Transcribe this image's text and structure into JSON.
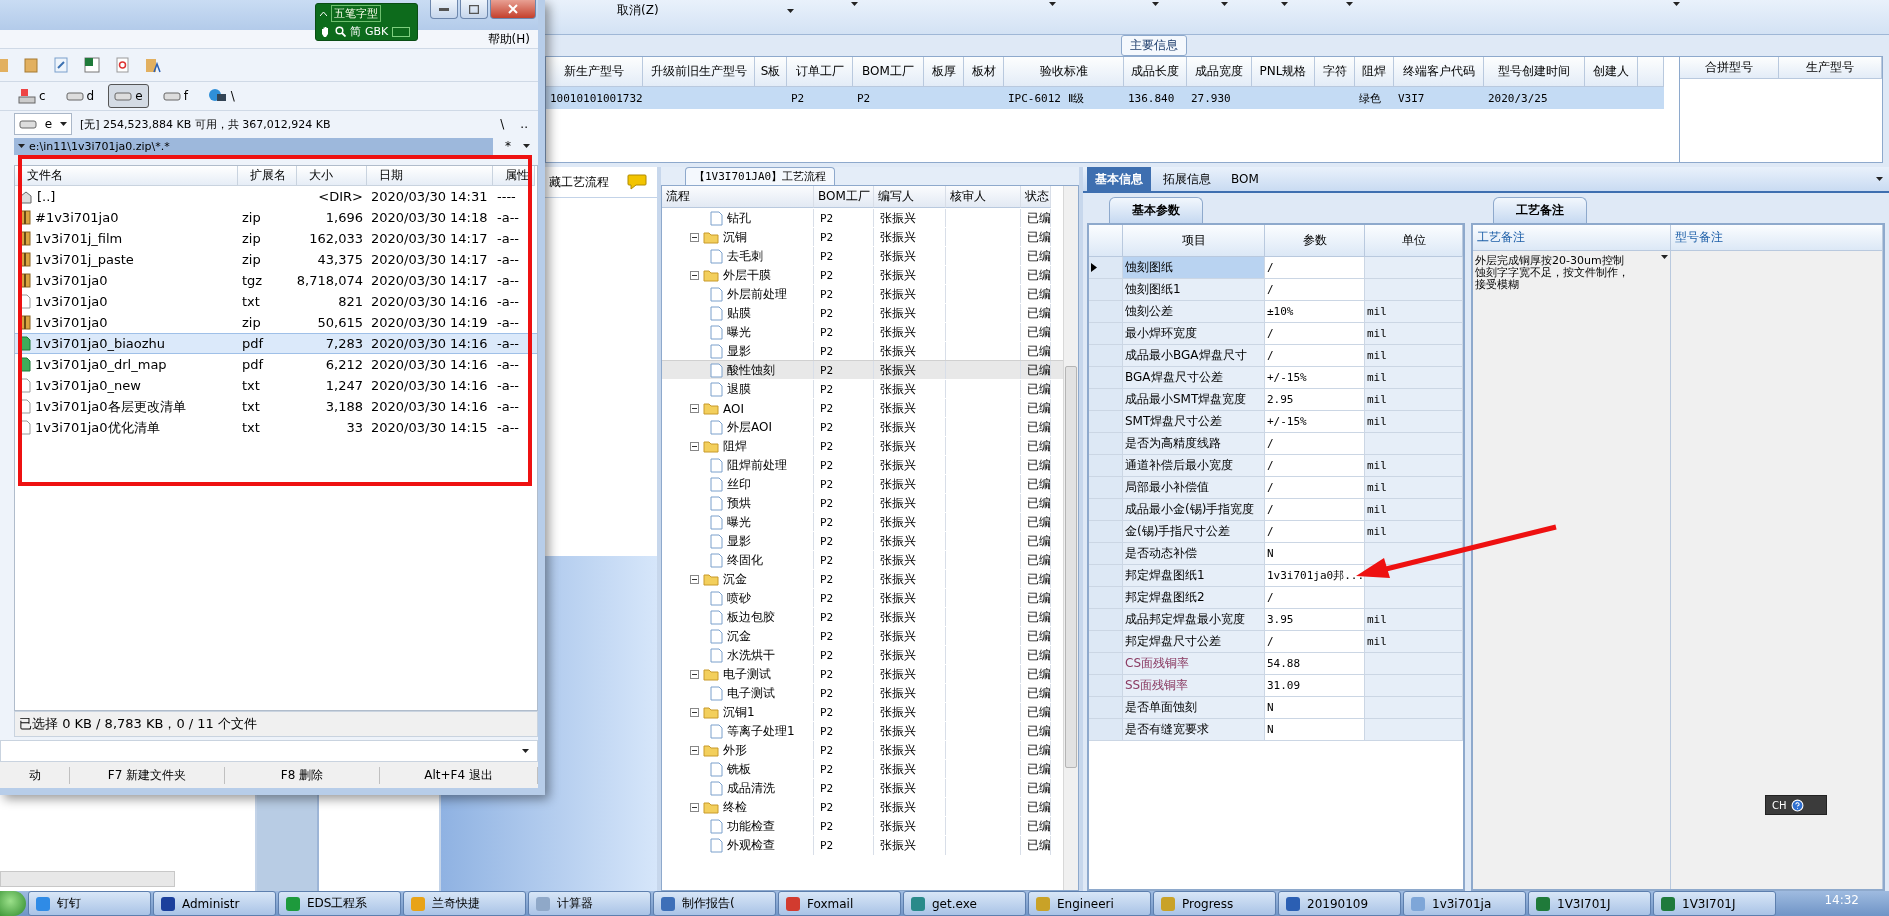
{
  "top_toolbar": {
    "cancel": "取消(Z)"
  },
  "main_info": {
    "title": "主要信息",
    "columns": [
      "新生产型号",
      "升级前旧生产型号",
      "S板",
      "订单工厂",
      "BOM工厂",
      "板厚",
      "板材",
      "验收标准",
      "成品长度",
      "成品宽度",
      "PNL规格",
      "字符",
      "阻焊",
      "终端客户代码",
      "型号创建时间",
      "创建人"
    ],
    "rows": [
      {
        "selected": true,
        "cells": [
          "10010101001732",
          null,
          null,
          "P2",
          "P2",
          null,
          null,
          "IPC-6012 Ⅱ级",
          "136.840",
          "27.930",
          null,
          null,
          "绿色",
          "V3I7",
          "2020/3/25",
          null
        ]
      }
    ],
    "side_columns": [
      "合拼型号",
      "生产型号"
    ]
  },
  "hidden_panel": {
    "tab": "藏工艺流程"
  },
  "process_flow": {
    "title": "【1V3I701JA0】工艺流程",
    "columns": [
      "流程",
      "BOM工厂",
      "编写人",
      "核审人",
      "状态"
    ],
    "groups": [
      {
        "children": [
          {
            "label": "钻孔",
            "bom": "P2",
            "writer": "张振兴",
            "status": "已编",
            "selected": false
          }
        ]
      },
      {
        "label": "沉铜",
        "bom": "P2",
        "writer": "张振兴",
        "status": "已编",
        "selected": false,
        "expanded": true,
        "children": [
          {
            "label": "去毛刺",
            "bom": "P2",
            "writer": "张振兴",
            "status": "已编",
            "selected": false
          }
        ]
      },
      {
        "label": "外层干膜",
        "bom": "P2",
        "writer": "张振兴",
        "status": "已编",
        "selected": false,
        "expanded": true,
        "children": [
          {
            "label": "外层前处理",
            "bom": "P2",
            "writer": "张振兴",
            "status": "已编",
            "selected": false
          },
          {
            "label": "贴膜",
            "bom": "P2",
            "writer": "张振兴",
            "status": "已编",
            "selected": false
          },
          {
            "label": "曝光",
            "bom": "P2",
            "writer": "张振兴",
            "status": "已编",
            "selected": false
          },
          {
            "label": "显影",
            "bom": "P2",
            "writer": "张振兴",
            "status": "已编",
            "selected": false
          },
          {
            "label": "酸性蚀刻",
            "bom": "P2",
            "writer": "张振兴",
            "status": "已编",
            "selected": true
          },
          {
            "label": "退膜",
            "bom": "P2",
            "writer": "张振兴",
            "status": "已编",
            "selected": false
          }
        ]
      },
      {
        "label": "AOI",
        "bom": "P2",
        "writer": "张振兴",
        "status": "已编",
        "selected": false,
        "expanded": true,
        "children": [
          {
            "label": "外层AOI",
            "bom": "P2",
            "writer": "张振兴",
            "status": "已编",
            "selected": false
          }
        ]
      },
      {
        "label": "阻焊",
        "bom": "P2",
        "writer": "张振兴",
        "status": "已编",
        "selected": false,
        "expanded": true,
        "children": [
          {
            "label": "阻焊前处理",
            "bom": "P2",
            "writer": "张振兴",
            "status": "已编",
            "selected": false
          },
          {
            "label": "丝印",
            "bom": "P2",
            "writer": "张振兴",
            "status": "已编",
            "selected": false
          },
          {
            "label": "预烘",
            "bom": "P2",
            "writer": "张振兴",
            "status": "已编",
            "selected": false
          },
          {
            "label": "曝光",
            "bom": "P2",
            "writer": "张振兴",
            "status": "已编",
            "selected": false
          },
          {
            "label": "显影",
            "bom": "P2",
            "writer": "张振兴",
            "status": "已编",
            "selected": false
          },
          {
            "label": "终固化",
            "bom": "P2",
            "writer": "张振兴",
            "status": "已编",
            "selected": false
          }
        ]
      },
      {
        "label": "沉金",
        "bom": "P2",
        "writer": "张振兴",
        "status": "已编",
        "selected": false,
        "expanded": true,
        "children": [
          {
            "label": "喷砂",
            "bom": "P2",
            "writer": "张振兴",
            "status": "已编",
            "selected": false
          },
          {
            "label": "板边包胶",
            "bom": "P2",
            "writer": "张振兴",
            "status": "已编",
            "selected": false
          },
          {
            "label": "沉金",
            "bom": "P2",
            "writer": "张振兴",
            "status": "已编",
            "selected": false
          },
          {
            "label": "水洗烘干",
            "bom": "P2",
            "writer": "张振兴",
            "status": "已编",
            "selected": false
          }
        ]
      },
      {
        "label": "电子测试",
        "bom": "P2",
        "writer": "张振兴",
        "status": "已编",
        "selected": false,
        "expanded": true,
        "children": [
          {
            "label": "电子测试",
            "bom": "P2",
            "writer": "张振兴",
            "status": "已编",
            "selected": false
          }
        ]
      },
      {
        "label": "沉铜1",
        "bom": "P2",
        "writer": "张振兴",
        "status": "已编",
        "selected": false,
        "expanded": true,
        "children": [
          {
            "label": "等离子处理1",
            "bom": "P2",
            "writer": "张振兴",
            "status": "已编",
            "selected": false
          }
        ]
      },
      {
        "label": "外形",
        "bom": "P2",
        "writer": "张振兴",
        "status": "已编",
        "selected": false,
        "expanded": true,
        "children": [
          {
            "label": "铣板",
            "bom": "P2",
            "writer": "张振兴",
            "status": "已编",
            "selected": false
          },
          {
            "label": "成品清洗",
            "bom": "P2",
            "writer": "张振兴",
            "status": "已编",
            "selected": false
          }
        ]
      },
      {
        "label": "终检",
        "bom": "P2",
        "writer": "张振兴",
        "status": "已编",
        "selected": false,
        "expanded": true,
        "children": [
          {
            "label": "功能检查",
            "bom": "P2",
            "writer": "张振兴",
            "status": "已编",
            "selected": false
          },
          {
            "label": "外观检查",
            "bom": "P2",
            "writer": "张振兴",
            "status": "已编",
            "selected": false
          }
        ]
      }
    ]
  },
  "detail": {
    "tabs": [
      {
        "label": "基本信息",
        "selected": true
      },
      {
        "label": "拓展信息",
        "selected": false
      },
      {
        "label": "BOM",
        "selected": false
      }
    ],
    "params": {
      "tab": "基本参数",
      "columns": [
        "项目",
        "参数",
        "单位"
      ],
      "rows": [
        {
          "item": "蚀刻图纸",
          "value": "/",
          "selected": true,
          "emphasized": false
        },
        {
          "item": "蚀刻图纸1",
          "value": "/",
          "selected": false,
          "emphasized": false
        },
        {
          "item": "蚀刻公差",
          "value": "±10%",
          "unit": "mil",
          "selected": false,
          "emphasized": false
        },
        {
          "item": "最小焊环宽度",
          "value": "/",
          "unit": "mil",
          "selected": false,
          "emphasized": false
        },
        {
          "item": "成品最小BGA焊盘尺寸",
          "value": "/",
          "unit": "mil",
          "selected": false,
          "emphasized": false
        },
        {
          "item": "BGA焊盘尺寸公差",
          "value": "+/-15%",
          "unit": "mil",
          "selected": false,
          "emphasized": false
        },
        {
          "item": "成品最小SMT焊盘宽度",
          "value": "2.95",
          "unit": "mil",
          "selected": false,
          "emphasized": false
        },
        {
          "item": "SMT焊盘尺寸公差",
          "value": "+/-15%",
          "unit": "mil",
          "selected": false,
          "emphasized": false
        },
        {
          "item": "是否为高精度线路",
          "value": "/",
          "selected": false,
          "emphasized": false
        },
        {
          "item": "通道补偿后最小宽度",
          "value": "/",
          "unit": "mil",
          "selected": false,
          "emphasized": false
        },
        {
          "item": "局部最小补偿值",
          "value": "/",
          "unit": "mil",
          "selected": false,
          "emphasized": false
        },
        {
          "item": "成品最小金(锡)手指宽度",
          "value": "/",
          "unit": "mil",
          "selected": false,
          "emphasized": false
        },
        {
          "item": "金(锡)手指尺寸公差",
          "value": "/",
          "unit": "mil",
          "selected": false,
          "emphasized": false
        },
        {
          "item": "是否动态补偿",
          "value": "N",
          "selected": false,
          "emphasized": false
        },
        {
          "item": "邦定焊盘图纸1",
          "value": "1v3i701ja0邦...",
          "selected": false,
          "emphasized": false
        },
        {
          "item": "邦定焊盘图纸2",
          "value": "/",
          "selected": false,
          "emphasized": false
        },
        {
          "item": "成品邦定焊盘最小宽度",
          "value": "3.95",
          "unit": "mil",
          "selected": false,
          "emphasized": false
        },
        {
          "item": "邦定焊盘尺寸公差",
          "value": "/",
          "unit": "mil",
          "selected": false,
          "emphasized": false
        },
        {
          "item": "CS面残铜率",
          "value": "54.88",
          "selected": false,
          "emphasized": true
        },
        {
          "item": "SS面残铜率",
          "value": "31.09",
          "selected": false,
          "emphasized": true
        },
        {
          "item": "是否单面蚀刻",
          "value": "N",
          "selected": false,
          "emphasized": false
        },
        {
          "item": "是否有缝宽要求",
          "value": "N",
          "selected": false,
          "emphasized": false
        }
      ]
    },
    "notes": {
      "tab": "工艺备注",
      "columns": [
        "工艺备注",
        "型号备注"
      ],
      "process_note": [
        "外层完成铜厚按20-30um控制",
        "蚀刻字字宽不足，按文件制作，",
        "接受模糊"
      ]
    }
  },
  "language_bar": {
    "code": "CH"
  },
  "file_manager": {
    "menu": [
      "帮助(H)"
    ],
    "ime_bar": {
      "mode": "五笔字型",
      "charset": "简",
      "encoding": "GBK"
    },
    "drives": [
      {
        "letter": "c",
        "kind": "system",
        "selected": false
      },
      {
        "letter": "d",
        "kind": "disk",
        "selected": false
      },
      {
        "letter": "e",
        "kind": "disk",
        "selected": true
      },
      {
        "letter": "f",
        "kind": "disk",
        "selected": false
      },
      {
        "letter": "\\",
        "kind": "network",
        "selected": false
      }
    ],
    "drive_select": "e",
    "free_space": "[无] 254,523,884 KB 可用，共 367,012,924 KB",
    "root_button": "\\",
    "up_button": "..",
    "path": "e:\\in11\\1v3i701ja0.zip\\*.*",
    "filter_button": "*",
    "columns": [
      "文件名",
      "扩展名",
      "大小",
      "日期",
      "属性"
    ],
    "files": [
      {
        "name": "[..]",
        "kind": "up",
        "size": "<DIR>",
        "date": "2020/03/30 14:31",
        "attr": "----",
        "selected": false
      },
      {
        "name": "#1v3i701ja0",
        "ext": "zip",
        "kind": "archive",
        "size": "1,696",
        "date": "2020/03/30 14:18",
        "attr": "-a--",
        "selected": false
      },
      {
        "name": "1v3i701j_film",
        "ext": "zip",
        "kind": "archive",
        "size": "162,033",
        "date": "2020/03/30 14:17",
        "attr": "-a--",
        "selected": false
      },
      {
        "name": "1v3i701j_paste",
        "ext": "zip",
        "kind": "archive",
        "size": "43,375",
        "date": "2020/03/30 14:17",
        "attr": "-a--",
        "selected": false
      },
      {
        "name": "1v3i701ja0",
        "ext": "tgz",
        "kind": "archive",
        "size": "8,718,074",
        "date": "2020/03/30 14:17",
        "attr": "-a--",
        "selected": false
      },
      {
        "name": "1v3i701ja0",
        "ext": "txt",
        "kind": "text",
        "size": "821",
        "date": "2020/03/30 14:16",
        "attr": "-a--",
        "selected": false
      },
      {
        "name": "1v3i701ja0",
        "ext": "zip",
        "kind": "archive",
        "size": "50,615",
        "date": "2020/03/30 14:19",
        "attr": "-a--",
        "selected": false
      },
      {
        "name": "1v3i701ja0_biaozhu",
        "ext": "pdf",
        "kind": "pdf",
        "size": "7,283",
        "date": "2020/03/30 14:16",
        "attr": "-a--",
        "selected": true
      },
      {
        "name": "1v3i701ja0_drl_map",
        "ext": "pdf",
        "kind": "pdf",
        "size": "6,212",
        "date": "2020/03/30 14:16",
        "attr": "-a--",
        "selected": false
      },
      {
        "name": "1v3i701ja0_new",
        "ext": "txt",
        "kind": "text",
        "size": "1,247",
        "date": "2020/03/30 14:16",
        "attr": "-a--",
        "selected": false
      },
      {
        "name": "1v3i701ja0各层更改清单",
        "ext": "txt",
        "kind": "text",
        "size": "3,188",
        "date": "2020/03/30 14:16",
        "attr": "-a--",
        "selected": false
      },
      {
        "name": "1v3i701ja0优化清单",
        "ext": "txt",
        "kind": "text",
        "size": "33",
        "date": "2020/03/30 14:15",
        "attr": "-a--",
        "selected": false
      }
    ],
    "status": "已选择 0 KB / 8,783 KB，0 / 11 个文件",
    "function_keys": [
      "动",
      "F7 新建文件夹",
      "F8 删除",
      "Alt+F4 退出"
    ]
  },
  "taskbar": {
    "items": [
      {
        "label": "钉钉",
        "color": "#2f8be6"
      },
      {
        "label": "Administr",
        "color": "#1b3f9c"
      },
      {
        "label": "EDS工程系",
        "color": "#1d9a3c"
      },
      {
        "label": "兰奇快捷",
        "color": "#e8a317"
      },
      {
        "label": "计算器",
        "color": "#8fa8c8"
      },
      {
        "label": "制作报告(",
        "color": "#3d6fb8"
      },
      {
        "label": "Foxmail",
        "color": "#d23b2f"
      },
      {
        "label": "get.exe",
        "color": "#2a8a8a"
      },
      {
        "label": "Engineeri",
        "color": "#c9a227"
      },
      {
        "label": "Progress",
        "color": "#c9a228"
      },
      {
        "label": "20190109",
        "color": "#2b5fb3"
      },
      {
        "label": "1v3i701ja",
        "color": "#7ea6d8"
      },
      {
        "label": "1V3I701J",
        "color": "#1f7a3a"
      },
      {
        "label": "1V3I701J",
        "color": "#1f7a3b"
      }
    ],
    "clock": "14:32"
  }
}
